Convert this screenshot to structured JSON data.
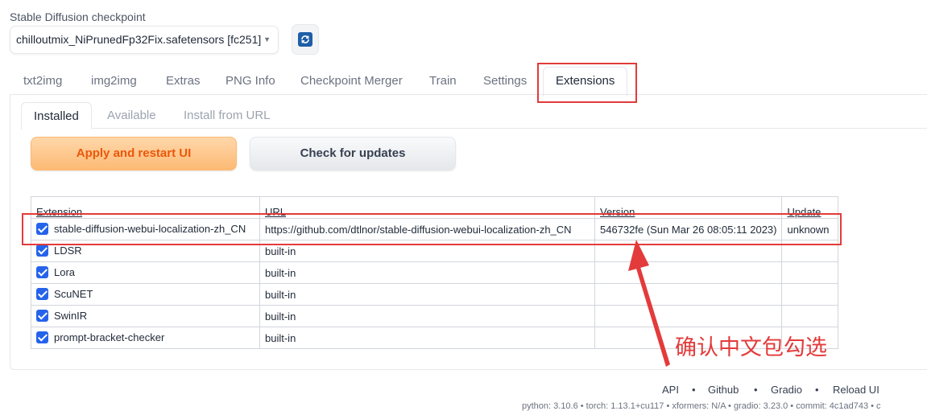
{
  "checkpoint": {
    "label": "Stable Diffusion checkpoint",
    "value": "chilloutmix_NiPrunedFp32Fix.safetensors [fc251]"
  },
  "tabs": [
    "txt2img",
    "img2img",
    "Extras",
    "PNG Info",
    "Checkpoint Merger",
    "Train",
    "Settings",
    "Extensions"
  ],
  "active_tab": "Extensions",
  "subtabs": [
    "Installed",
    "Available",
    "Install from URL"
  ],
  "active_subtab": "Installed",
  "buttons": {
    "apply": "Apply and restart UI",
    "check": "Check for updates"
  },
  "table": {
    "headers": [
      "Extension",
      "URL",
      "Version",
      "Update"
    ],
    "rows": [
      {
        "name": "stable-diffusion-webui-localization-zh_CN",
        "url": "https://github.com/dtlnor/stable-diffusion-webui-localization-zh_CN",
        "version": "546732fe (Sun Mar 26 08:05:11 2023)",
        "update": "unknown",
        "checked": true
      },
      {
        "name": "LDSR",
        "url": "built-in",
        "version": "",
        "update": "",
        "checked": true
      },
      {
        "name": "Lora",
        "url": "built-in",
        "version": "",
        "update": "",
        "checked": true
      },
      {
        "name": "ScuNET",
        "url": "built-in",
        "version": "",
        "update": "",
        "checked": true
      },
      {
        "name": "SwinIR",
        "url": "built-in",
        "version": "",
        "update": "",
        "checked": true
      },
      {
        "name": "prompt-bracket-checker",
        "url": "built-in",
        "version": "",
        "update": "",
        "checked": true
      }
    ]
  },
  "annotation": "确认中文包勾选",
  "footer": {
    "links": [
      "API",
      "Github",
      "Gradio",
      "Reload UI"
    ],
    "separator": "•",
    "meta": "python: 3.10.6  •  torch: 1.13.1+cu117  •  xformers: N/A  •  gradio: 3.23.0  •  commit: 4c1ad743  •  c"
  },
  "colors": {
    "accent_orange": "#ea580c",
    "checkbox_blue": "#2563eb",
    "annotation_red": "#e33b3b"
  }
}
